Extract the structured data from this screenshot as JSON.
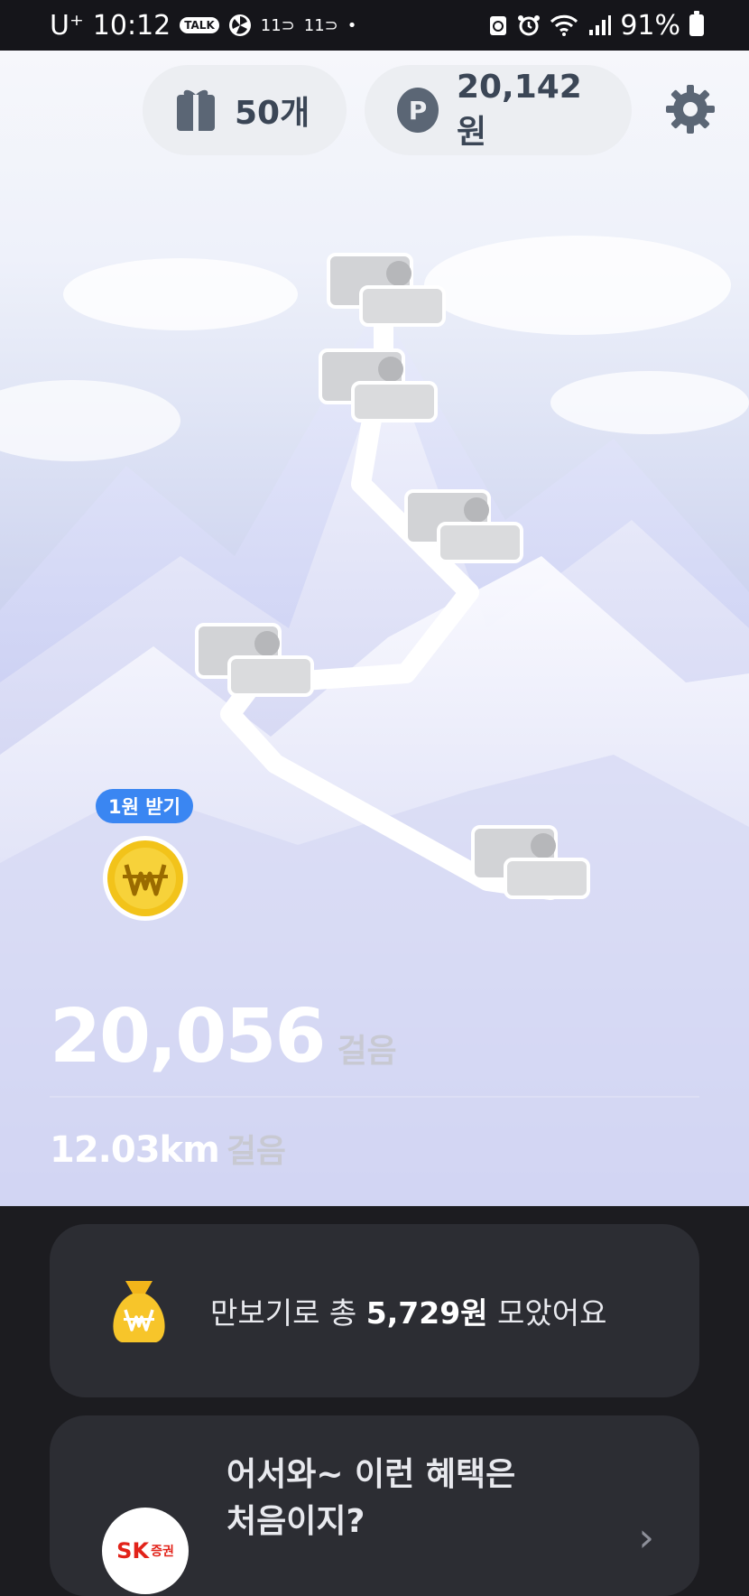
{
  "status_bar": {
    "carrier": "U⁺",
    "time": "10:12",
    "talk_badge": "TALK",
    "eleven_a": "11⊃",
    "eleven_b": "11⊃",
    "dot": "•",
    "battery_percent": "91%"
  },
  "header": {
    "gift_count": "50개",
    "point_badge": "P",
    "points": "20,142원"
  },
  "coin": {
    "label": "1원 받기"
  },
  "steps": {
    "count": "20,056",
    "unit": "걸음"
  },
  "distance": {
    "value": "12.03km",
    "unit": "걸음"
  },
  "card_savings": {
    "prefix": "만보기로 총 ",
    "amount": "5,729원",
    "suffix": " 모았어요"
  },
  "card_promo": {
    "line1": "어서와~ 이런 혜택은",
    "line2": "처음이지?",
    "logo_sk": "SK",
    "logo_text": "증권",
    "chevron": "›"
  },
  "colors": {
    "accent_blue": "#3a86f2",
    "card_bg": "#2c2d33",
    "coin_gold": "#f2c31a"
  },
  "icons": [
    "gift-icon",
    "gear-icon",
    "coin-icon",
    "money-bag-icon",
    "chevron-right-icon"
  ]
}
